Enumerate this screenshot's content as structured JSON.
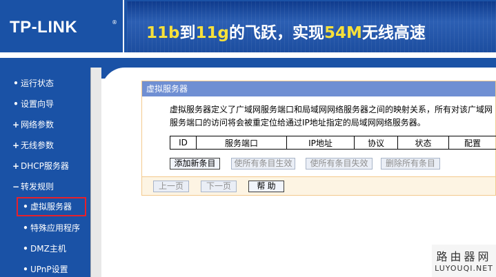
{
  "header": {
    "logo": "TP-LINK",
    "logo_reg": "®",
    "slogan_parts": [
      "11b",
      "到",
      "11g",
      "的飞跃，实现",
      "54M",
      "无线高速"
    ]
  },
  "sidebar": {
    "items": [
      {
        "mark": "•",
        "label": "运行状态"
      },
      {
        "mark": "•",
        "label": "设置向导"
      },
      {
        "mark": "+",
        "label": "网络参数"
      },
      {
        "mark": "+",
        "label": "无线参数"
      },
      {
        "mark": "+",
        "label": "DHCP服务器"
      },
      {
        "mark": "−",
        "label": "转发规则"
      }
    ],
    "subitems": [
      {
        "mark": "•",
        "label": "虚拟服务器",
        "selected": true
      },
      {
        "mark": "•",
        "label": "特殊应用程序"
      },
      {
        "mark": "•",
        "label": "DMZ主机"
      },
      {
        "mark": "•",
        "label": "UPnP设置"
      }
    ]
  },
  "panel": {
    "title": "虚拟服务器",
    "description": "虚拟服务器定义了广域网服务端口和局域网网络服务器之间的映射关系，所有对该广域网服务端口的访问将会被重定位给通过IP地址指定的局域网网络服务器。",
    "table_headers": [
      "ID",
      "服务端口",
      "IP地址",
      "协议",
      "状态",
      "配置"
    ],
    "buttons": {
      "add": "添加新条目",
      "enable_all": "使所有条目生效",
      "disable_all": "使所有条目失效",
      "delete_all": "删除所有条目"
    },
    "footer_buttons": {
      "prev": "上一页",
      "next": "下一页",
      "help": "帮 助"
    }
  },
  "watermark": {
    "line1": "路由器网",
    "line2": "LUYOUQI.NET"
  },
  "colors": {
    "brand_blue": "#1a52a6",
    "panel_title": "#6f8fd3",
    "panel_border": "#f3c98c",
    "highlight_red": "#e8202a",
    "slogan_yellow": "#f6e03a"
  }
}
